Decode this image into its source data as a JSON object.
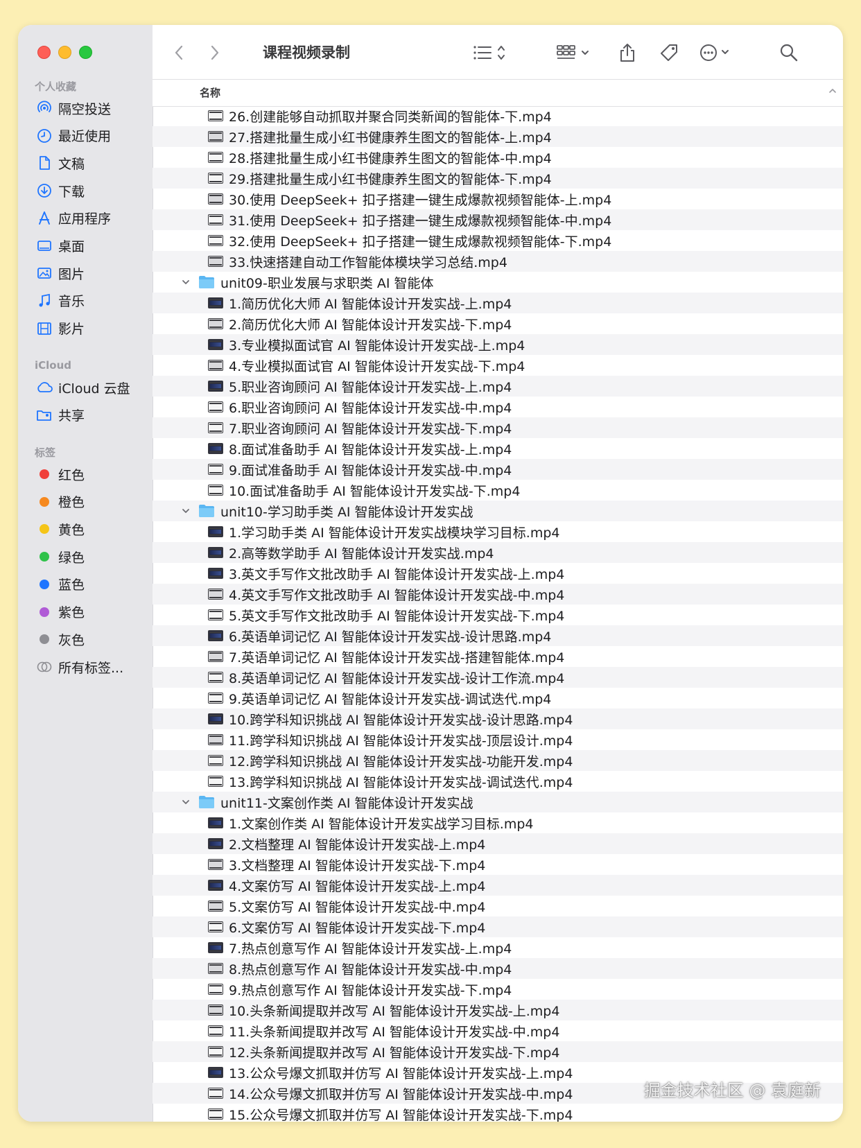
{
  "window": {
    "title": "课程视频录制"
  },
  "sidebar": {
    "favorites_header": "个人收藏",
    "favorites": [
      {
        "label": "隔空投送",
        "icon": "airdrop-icon"
      },
      {
        "label": "最近使用",
        "icon": "clock-icon"
      },
      {
        "label": "文稿",
        "icon": "document-icon"
      },
      {
        "label": "下载",
        "icon": "download-icon"
      },
      {
        "label": "应用程序",
        "icon": "applications-icon"
      },
      {
        "label": "桌面",
        "icon": "desktop-icon"
      },
      {
        "label": "图片",
        "icon": "photo-icon"
      },
      {
        "label": "音乐",
        "icon": "music-icon"
      },
      {
        "label": "影片",
        "icon": "film-icon"
      }
    ],
    "icloud_header": "iCloud",
    "icloud": [
      {
        "label": "iCloud 云盘",
        "icon": "cloud-icon"
      },
      {
        "label": "共享",
        "icon": "shared-folder-icon"
      }
    ],
    "tags_header": "标签",
    "tags": [
      {
        "label": "红色",
        "color": "#f0403a"
      },
      {
        "label": "橙色",
        "color": "#f6891f"
      },
      {
        "label": "黄色",
        "color": "#f5c518"
      },
      {
        "label": "绿色",
        "color": "#30c24a"
      },
      {
        "label": "蓝色",
        "color": "#1f75ff"
      },
      {
        "label": "紫色",
        "color": "#b05bd6"
      },
      {
        "label": "灰色",
        "color": "#8e8e93"
      }
    ],
    "all_tags": "所有标签..."
  },
  "list": {
    "column_name": "名称",
    "rows": [
      {
        "type": "file",
        "name": "26.创建能够自动抓取并聚合同类新闻的智能体-下.mp4",
        "thumb": "white"
      },
      {
        "type": "file",
        "name": "27.搭建批量生成小红书健康养生图文的智能体-上.mp4",
        "thumb": "light"
      },
      {
        "type": "file",
        "name": "28.搭建批量生成小红书健康养生图文的智能体-中.mp4",
        "thumb": "white"
      },
      {
        "type": "file",
        "name": "29.搭建批量生成小红书健康养生图文的智能体-下.mp4",
        "thumb": "white"
      },
      {
        "type": "file",
        "name": "30.使用 DeepSeek+ 扣子搭建一键生成爆款视频智能体-上.mp4",
        "thumb": "light"
      },
      {
        "type": "file",
        "name": "31.使用 DeepSeek+ 扣子搭建一键生成爆款视频智能体-中.mp4",
        "thumb": "white"
      },
      {
        "type": "file",
        "name": "32.使用 DeepSeek+ 扣子搭建一键生成爆款视频智能体-下.mp4",
        "thumb": "white"
      },
      {
        "type": "file",
        "name": "33.快速搭建自动工作智能体模块学习总结.mp4",
        "thumb": "light"
      },
      {
        "type": "folder",
        "name": "unit09-职业发展与求职类 AI 智能体"
      },
      {
        "type": "file",
        "name": "1.简历优化大师 AI 智能体设计开发实战-上.mp4",
        "thumb": "dark"
      },
      {
        "type": "file",
        "name": "2.简历优化大师 AI 智能体设计开发实战-下.mp4",
        "thumb": "light"
      },
      {
        "type": "file",
        "name": "3.专业模拟面试官 AI 智能体设计开发实战-上.mp4",
        "thumb": "dark"
      },
      {
        "type": "file",
        "name": "4.专业模拟面试官 AI 智能体设计开发实战-下.mp4",
        "thumb": "light"
      },
      {
        "type": "file",
        "name": "5.职业咨询顾问 AI 智能体设计开发实战-上.mp4",
        "thumb": "dark"
      },
      {
        "type": "file",
        "name": "6.职业咨询顾问 AI 智能体设计开发实战-中.mp4",
        "thumb": "white"
      },
      {
        "type": "file",
        "name": "7.职业咨询顾问 AI 智能体设计开发实战-下.mp4",
        "thumb": "white"
      },
      {
        "type": "file",
        "name": "8.面试准备助手 AI 智能体设计开发实战-上.mp4",
        "thumb": "dark"
      },
      {
        "type": "file",
        "name": "9.面试准备助手 AI 智能体设计开发实战-中.mp4",
        "thumb": "white"
      },
      {
        "type": "file",
        "name": "10.面试准备助手 AI 智能体设计开发实战-下.mp4",
        "thumb": "white"
      },
      {
        "type": "folder",
        "name": "unit10-学习助手类 AI 智能体设计开发实战"
      },
      {
        "type": "file",
        "name": "1.学习助手类 AI 智能体设计开发实战模块学习目标.mp4",
        "thumb": "dark"
      },
      {
        "type": "file",
        "name": "2.高等数学助手 AI 智能体设计开发实战.mp4",
        "thumb": "dark"
      },
      {
        "type": "file",
        "name": "3.英文手写作文批改助手 AI 智能体设计开发实战-上.mp4",
        "thumb": "dark"
      },
      {
        "type": "file",
        "name": "4.英文手写作文批改助手 AI 智能体设计开发实战-中.mp4",
        "thumb": "light"
      },
      {
        "type": "file",
        "name": "5.英文手写作文批改助手 AI 智能体设计开发实战-下.mp4",
        "thumb": "white"
      },
      {
        "type": "file",
        "name": "6.英语单词记忆 AI 智能体设计开发实战-设计思路.mp4",
        "thumb": "dark"
      },
      {
        "type": "file",
        "name": "7.英语单词记忆 AI 智能体设计开发实战-搭建智能体.mp4",
        "thumb": "light"
      },
      {
        "type": "file",
        "name": "8.英语单词记忆 AI 智能体设计开发实战-设计工作流.mp4",
        "thumb": "white"
      },
      {
        "type": "file",
        "name": "9.英语单词记忆 AI 智能体设计开发实战-调试迭代.mp4",
        "thumb": "white"
      },
      {
        "type": "file",
        "name": "10.跨学科知识挑战 AI 智能体设计开发实战-设计思路.mp4",
        "thumb": "dark"
      },
      {
        "type": "file",
        "name": "11.跨学科知识挑战 AI 智能体设计开发实战-顶层设计.mp4",
        "thumb": "light"
      },
      {
        "type": "file",
        "name": "12.跨学科知识挑战 AI 智能体设计开发实战-功能开发.mp4",
        "thumb": "white"
      },
      {
        "type": "file",
        "name": "13.跨学科知识挑战 AI 智能体设计开发实战-调试迭代.mp4",
        "thumb": "white"
      },
      {
        "type": "folder",
        "name": "unit11-文案创作类 AI 智能体设计开发实战"
      },
      {
        "type": "file",
        "name": "1.文案创作类 AI 智能体设计开发实战学习目标.mp4",
        "thumb": "dark"
      },
      {
        "type": "file",
        "name": "2.文档整理 AI 智能体设计开发实战-上.mp4",
        "thumb": "dark"
      },
      {
        "type": "file",
        "name": "3.文档整理 AI 智能体设计开发实战-下.mp4",
        "thumb": "light"
      },
      {
        "type": "file",
        "name": "4.文案仿写 AI 智能体设计开发实战-上.mp4",
        "thumb": "dark"
      },
      {
        "type": "file",
        "name": "5.文案仿写 AI 智能体设计开发实战-中.mp4",
        "thumb": "light"
      },
      {
        "type": "file",
        "name": "6.文案仿写 AI 智能体设计开发实战-下.mp4",
        "thumb": "white"
      },
      {
        "type": "file",
        "name": "7.热点创意写作 AI 智能体设计开发实战-上.mp4",
        "thumb": "dark"
      },
      {
        "type": "file",
        "name": "8.热点创意写作 AI 智能体设计开发实战-中.mp4",
        "thumb": "light"
      },
      {
        "type": "file",
        "name": "9.热点创意写作 AI 智能体设计开发实战-下.mp4",
        "thumb": "white"
      },
      {
        "type": "file",
        "name": "10.头条新闻提取并改写 AI 智能体设计开发实战-上.mp4",
        "thumb": "light"
      },
      {
        "type": "file",
        "name": "11.头条新闻提取并改写 AI 智能体设计开发实战-中.mp4",
        "thumb": "white"
      },
      {
        "type": "file",
        "name": "12.头条新闻提取并改写 AI 智能体设计开发实战-下.mp4",
        "thumb": "white"
      },
      {
        "type": "file",
        "name": "13.公众号爆文抓取并仿写 AI 智能体设计开发实战-上.mp4",
        "thumb": "dark"
      },
      {
        "type": "file",
        "name": "14.公众号爆文抓取并仿写 AI 智能体设计开发实战-中.mp4",
        "thumb": "white"
      },
      {
        "type": "file",
        "name": "15.公众号爆文抓取并仿写 AI 智能体设计开发实战-下.mp4",
        "thumb": "white"
      }
    ]
  },
  "watermark": "掘金技术社区 @ 袁庭新"
}
